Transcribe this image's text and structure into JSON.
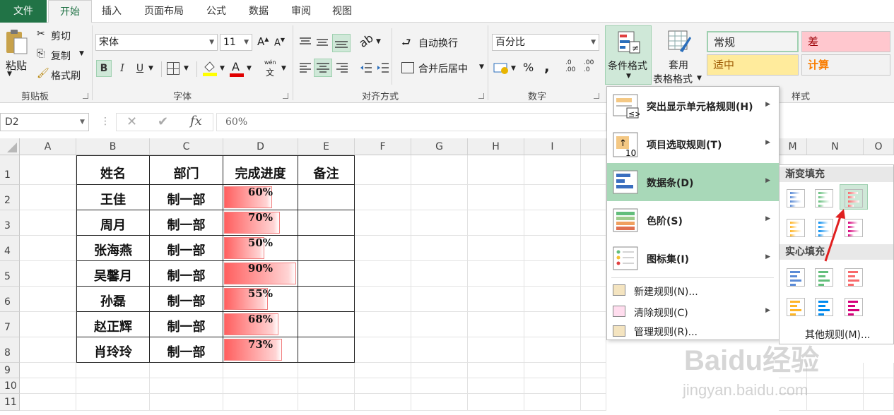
{
  "tabs": [
    "文件",
    "开始",
    "插入",
    "页面布局",
    "公式",
    "数据",
    "审阅",
    "视图"
  ],
  "active_tab": "开始",
  "clipboard": {
    "paste": "粘贴",
    "cut": "剪切",
    "copy": "复制",
    "format_painter": "格式刷",
    "group": "剪贴板"
  },
  "font": {
    "name": "宋体",
    "size": "11",
    "grow": "A",
    "shrink": "A",
    "bold": "B",
    "italic": "I",
    "underline": "U",
    "group": "字体",
    "fill_letter": "A",
    "wen": "wén",
    "wen_char": "文"
  },
  "alignment": {
    "wrap": "自动换行",
    "merge": "合并后居中",
    "group": "对齐方式"
  },
  "number": {
    "format": "百分比",
    "percent": "%",
    "comma": ",",
    "inc": ".0 .00",
    "dec": ".00 .0",
    "group": "数字"
  },
  "styles_group": {
    "cond_format": "条件格式",
    "table_format_1": "套用",
    "table_format_2": "表格格式",
    "cells": [
      {
        "label": "常规",
        "bg": "#ffffff",
        "fg": "#222222"
      },
      {
        "label": "差",
        "bg": "#ffc7ce",
        "fg": "#9c0006"
      },
      {
        "label": "适中",
        "bg": "#ffeb9c",
        "fg": "#9c5700"
      },
      {
        "label": "计算",
        "bg": "#f2f2f2",
        "fg": "#fa7d00"
      }
    ],
    "group": "样式"
  },
  "formula_bar": {
    "name_box": "D2",
    "cancel": "✕",
    "enter": "✔",
    "fx": "fx",
    "value": "60%"
  },
  "columns": [
    "A",
    "B",
    "C",
    "D",
    "E",
    "F",
    "G",
    "H",
    "I",
    "M",
    "N",
    "O"
  ],
  "rows": [
    "1",
    "2",
    "3",
    "4",
    "5",
    "6",
    "7",
    "8",
    "9",
    "10",
    "11"
  ],
  "table": {
    "headers": [
      "姓名",
      "部门",
      "完成进度",
      "备注"
    ],
    "records": [
      {
        "name": "王佳",
        "dept": "制一部",
        "progress": "60%",
        "fraction": 0.6
      },
      {
        "name": "周月",
        "dept": "制一部",
        "progress": "70%",
        "fraction": 0.7
      },
      {
        "name": "张海燕",
        "dept": "制一部",
        "progress": "50%",
        "fraction": 0.5
      },
      {
        "name": "吴馨月",
        "dept": "制一部",
        "progress": "90%",
        "fraction": 0.9
      },
      {
        "name": "孙磊",
        "dept": "制一部",
        "progress": "55%",
        "fraction": 0.55
      },
      {
        "name": "赵正辉",
        "dept": "制一部",
        "progress": "68%",
        "fraction": 0.68
      },
      {
        "name": "肖玲玲",
        "dept": "制一部",
        "progress": "73%",
        "fraction": 0.73
      }
    ]
  },
  "cond_menu": {
    "items": [
      "突出显示单元格规则(H)",
      "项目选取规则(T)",
      "数据条(D)",
      "色阶(S)",
      "图标集(I)"
    ],
    "small_items": [
      "新建规则(N)...",
      "清除规则(C)",
      "管理规则(R)..."
    ],
    "highlighted": "数据条(D)"
  },
  "databar_submenu": {
    "gradient_title": "渐变填充",
    "solid_title": "实心填充",
    "more_rules": "其他规则(M)...",
    "colors": [
      "#5b8bd6",
      "#63be7b",
      "#f8696b",
      "#ffb628",
      "#008aef",
      "#d6007b"
    ]
  },
  "watermark": {
    "brand": "Baidu经验",
    "url": "jingyan.baidu.com"
  }
}
